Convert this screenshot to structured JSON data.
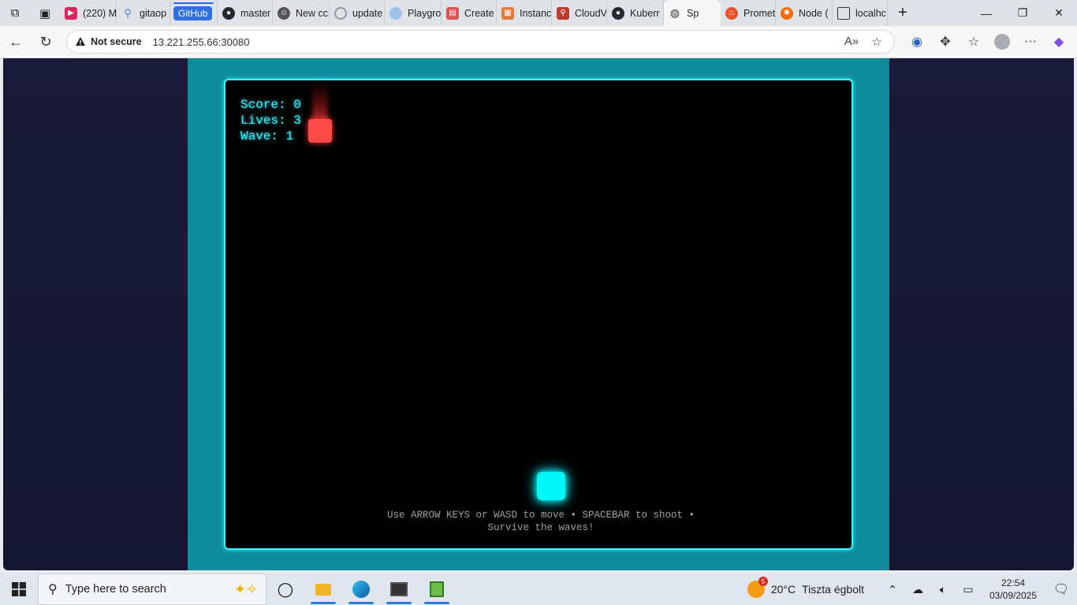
{
  "tabs": [
    {
      "label": "(220) M",
      "icon": "youtube-icon",
      "color": "#e0245e"
    },
    {
      "label": "gitaop",
      "icon": "search-icon",
      "color": "#4a7fd9"
    },
    {
      "label": "GitHub",
      "icon": "github-badge",
      "color": "#2f6fe0"
    },
    {
      "label": "master",
      "icon": "github-icon",
      "color": "#24292f"
    },
    {
      "label": "New cc",
      "icon": "copilot-icon",
      "color": "#444444"
    },
    {
      "label": "update",
      "icon": "loading-icon",
      "color": "#888888"
    },
    {
      "label": "Playgro",
      "icon": "cloud-icon",
      "color": "#8fb6e3"
    },
    {
      "label": "Create",
      "icon": "app-icon",
      "color": "#d9534f"
    },
    {
      "label": "Instanc",
      "icon": "app-icon",
      "color": "#e07b39"
    },
    {
      "label": "CloudV",
      "icon": "search-icon",
      "color": "#c0392b"
    },
    {
      "label": "Kuberr",
      "icon": "github-icon",
      "color": "#24292f"
    },
    {
      "label": "Sp",
      "icon": "globe-icon",
      "color": "#333333"
    },
    {
      "label": "Promet",
      "icon": "fire-icon",
      "color": "#e6522c"
    },
    {
      "label": "Node (",
      "icon": "grafana-icon",
      "color": "#f46800"
    },
    {
      "label": "localhc",
      "icon": "page-icon",
      "color": "#333333"
    }
  ],
  "address": {
    "security_label": "Not secure",
    "url": "13.221.255.66:30080"
  },
  "game": {
    "score_label": "Score: 0",
    "lives_label": "Lives: 3",
    "wave_label": "Wave: 1",
    "instructions": "Use ARROW KEYS or WASD to move • SPACEBAR to shoot • Survive the waves!",
    "player_color": "#00f7f7",
    "enemy_color": "#ff4a4a",
    "border_color": "#3ff6ff",
    "frame_color": "#0e8b9b"
  },
  "taskbar": {
    "search_placeholder": "Type here to search",
    "weather_temp": "20°C",
    "weather_text": "Tiszta égbolt",
    "weather_badge": "5",
    "time": "22:54",
    "date": "03/09/2025"
  }
}
